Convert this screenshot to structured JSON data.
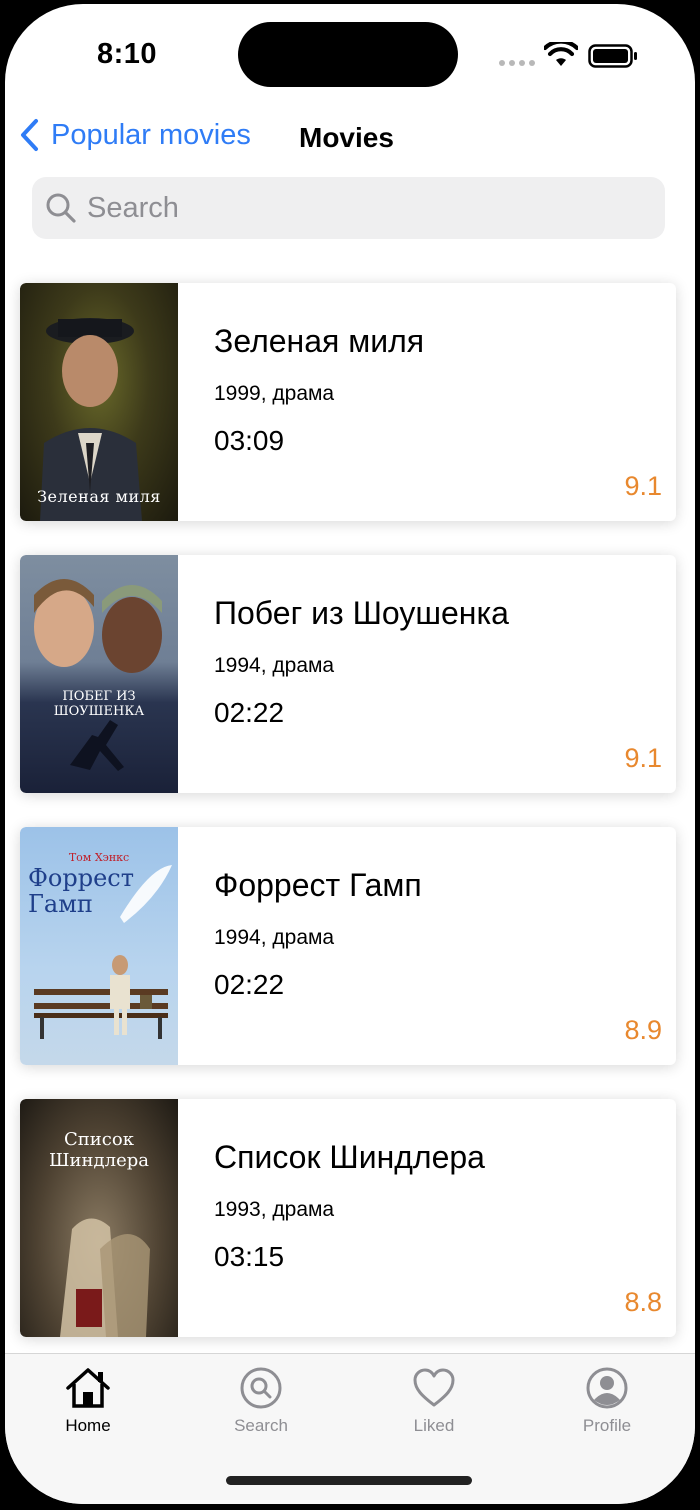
{
  "status_bar": {
    "time": "8:10"
  },
  "nav": {
    "back_label": "Popular movies",
    "title": "Movies"
  },
  "search": {
    "placeholder": "Search"
  },
  "movies": [
    {
      "title": "Зеленая миля",
      "meta": "1999, драма",
      "duration": "03:09",
      "rating": "9.1",
      "poster_text": "Зеленая миля"
    },
    {
      "title": "Побег из Шоушенка",
      "meta": "1994, драма",
      "duration": "02:22",
      "rating": "9.1",
      "poster_text": "ПОБЕГ ИЗ ШОУШЕНКА"
    },
    {
      "title": "Форрест Гамп",
      "meta": "1994, драма",
      "duration": "02:22",
      "rating": "8.9",
      "poster_top": "Том Хэнкс",
      "poster_text": "Форрест Гамп"
    },
    {
      "title": "Список Шиндлера",
      "meta": "1993, драма",
      "duration": "03:15",
      "rating": "8.8",
      "poster_text": "Список Шиндлера"
    }
  ],
  "tabs": [
    {
      "label": "Home",
      "icon": "home-icon",
      "active": true
    },
    {
      "label": "Search",
      "icon": "search-icon",
      "active": false
    },
    {
      "label": "Liked",
      "icon": "heart-icon",
      "active": false
    },
    {
      "label": "Profile",
      "icon": "profile-icon",
      "active": false
    }
  ],
  "colors": {
    "accent": "#2f7cf6",
    "rating": "#e8882e",
    "inactive_tab": "#8e8e93"
  }
}
